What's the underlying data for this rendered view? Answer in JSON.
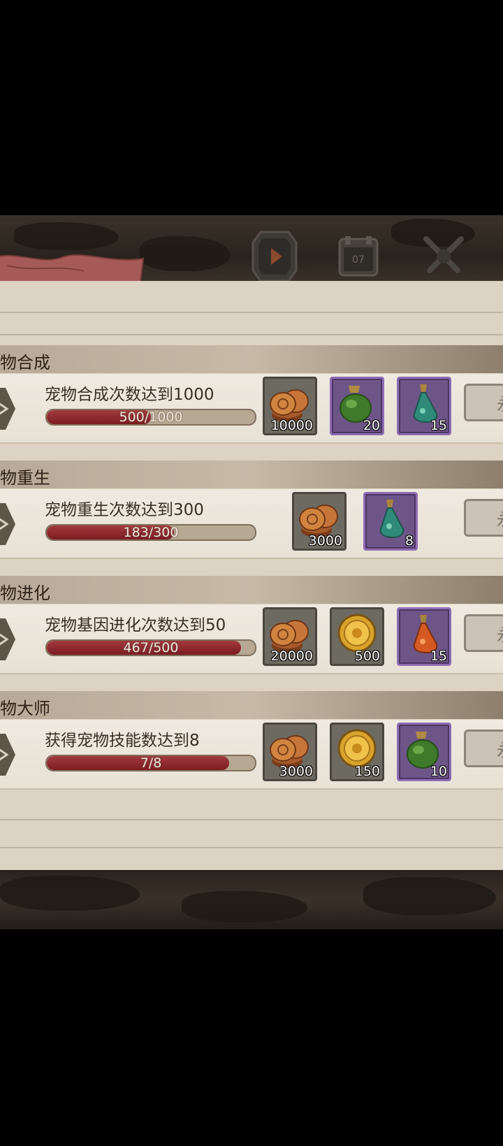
{
  "sections": [
    {
      "title": "物合成",
      "quest": "宠物合成次数达到1000",
      "progress_text": "500/1000",
      "progress_value": 0.5,
      "claim_label": "永",
      "rewards": [
        {
          "icon": "bronze-coins-icon",
          "count": "10000",
          "frame": "gray"
        },
        {
          "icon": "green-potion-bag-icon",
          "count": "20",
          "frame": "purple"
        },
        {
          "icon": "teal-flask-icon",
          "count": "15",
          "frame": "purple"
        }
      ]
    },
    {
      "title": "物重生",
      "quest": "宠物重生次数达到300",
      "progress_text": "183/300",
      "progress_value": 0.61,
      "claim_label": "永",
      "rewards": [
        {
          "icon": "bronze-coins-icon",
          "count": "3000",
          "frame": "gray"
        },
        {
          "icon": "teal-flask-icon",
          "count": "8",
          "frame": "purple"
        }
      ]
    },
    {
      "title": "物进化",
      "quest": "宠物基因进化次数达到50",
      "progress_text": "467/500",
      "progress_value": 0.934,
      "claim_label": "永",
      "rewards": [
        {
          "icon": "bronze-coins-icon",
          "count": "20000",
          "frame": "gray"
        },
        {
          "icon": "gold-sun-coin-icon",
          "count": "500",
          "frame": "gray"
        },
        {
          "icon": "orange-potion-icon",
          "count": "15",
          "frame": "purple"
        }
      ]
    },
    {
      "title": "物大师",
      "quest": "获得宠物技能数达到8",
      "progress_text": "7/8",
      "progress_value": 0.875,
      "claim_label": "永",
      "rewards": [
        {
          "icon": "bronze-coins-icon",
          "count": "3000",
          "frame": "gray"
        },
        {
          "icon": "gold-sun-coin-icon",
          "count": "150",
          "frame": "gray"
        },
        {
          "icon": "green-potion-bag-icon",
          "count": "10",
          "frame": "purple"
        }
      ]
    }
  ],
  "top_bar": {
    "calendar_day": "07"
  },
  "colors": {
    "panel": "#ddd3c4",
    "progress_fill": "#8b2630",
    "purple_frame": "#8f6db4"
  }
}
